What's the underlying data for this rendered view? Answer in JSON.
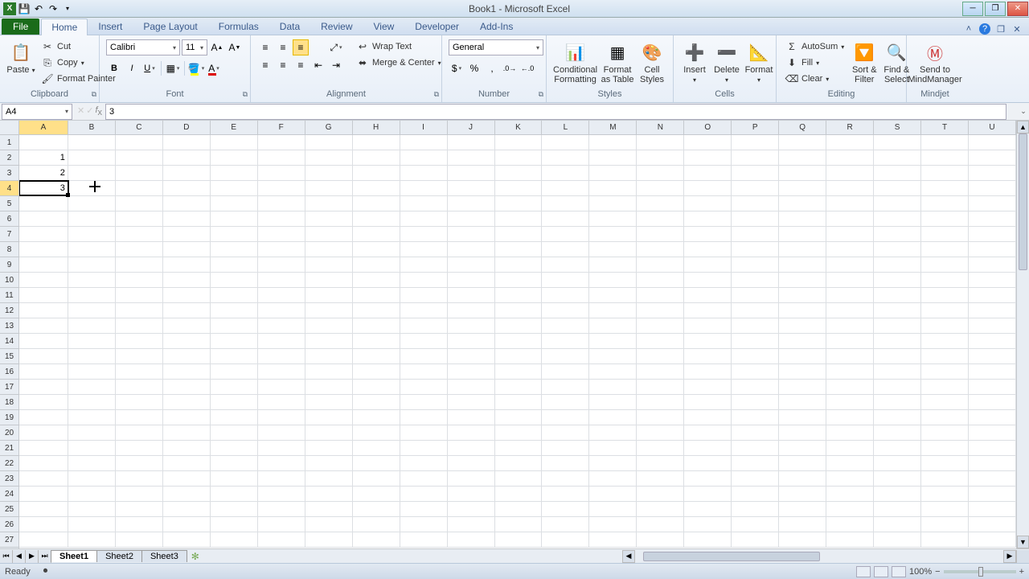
{
  "titlebar": {
    "title": "Book1 - Microsoft Excel"
  },
  "qat": {
    "excel": "X",
    "save": "💾",
    "undo": "↶",
    "redo": "↷",
    "custom": "▾"
  },
  "tabs": {
    "file": "File",
    "list": [
      "Home",
      "Insert",
      "Page Layout",
      "Formulas",
      "Data",
      "Review",
      "View",
      "Developer",
      "Add-Ins"
    ],
    "active": "Home"
  },
  "ribbon": {
    "clipboard": {
      "label": "Clipboard",
      "paste": "Paste",
      "cut": "Cut",
      "copy": "Copy",
      "fmtpainter": "Format Painter"
    },
    "font": {
      "label": "Font",
      "name": "Calibri",
      "size": "11"
    },
    "alignment": {
      "label": "Alignment",
      "wrap": "Wrap Text",
      "merge": "Merge & Center"
    },
    "number": {
      "label": "Number",
      "format": "General"
    },
    "styles": {
      "label": "Styles",
      "cond": "Conditional\nFormatting",
      "table": "Format\nas Table",
      "cell": "Cell\nStyles"
    },
    "cells": {
      "label": "Cells",
      "insert": "Insert",
      "delete": "Delete",
      "format": "Format"
    },
    "editing": {
      "label": "Editing",
      "autosum": "AutoSum",
      "fill": "Fill",
      "clear": "Clear",
      "sort": "Sort &\nFilter",
      "find": "Find &\nSelect"
    },
    "mindjet": {
      "label": "Mindjet",
      "send": "Send to\nMindManager"
    }
  },
  "namebox": "A4",
  "formula": "3",
  "columns": [
    "A",
    "B",
    "C",
    "D",
    "E",
    "F",
    "G",
    "H",
    "I",
    "J",
    "K",
    "L",
    "M",
    "N",
    "O",
    "P",
    "Q",
    "R",
    "S",
    "T",
    "U"
  ],
  "rows_count": 27,
  "cell_data": {
    "A2": "1",
    "A3": "2",
    "A4": "3"
  },
  "active_cell": {
    "col": 0,
    "row": 3
  },
  "sheets": {
    "list": [
      "Sheet1",
      "Sheet2",
      "Sheet3"
    ],
    "active": "Sheet1"
  },
  "status": {
    "ready": "Ready",
    "zoom": "100%"
  }
}
